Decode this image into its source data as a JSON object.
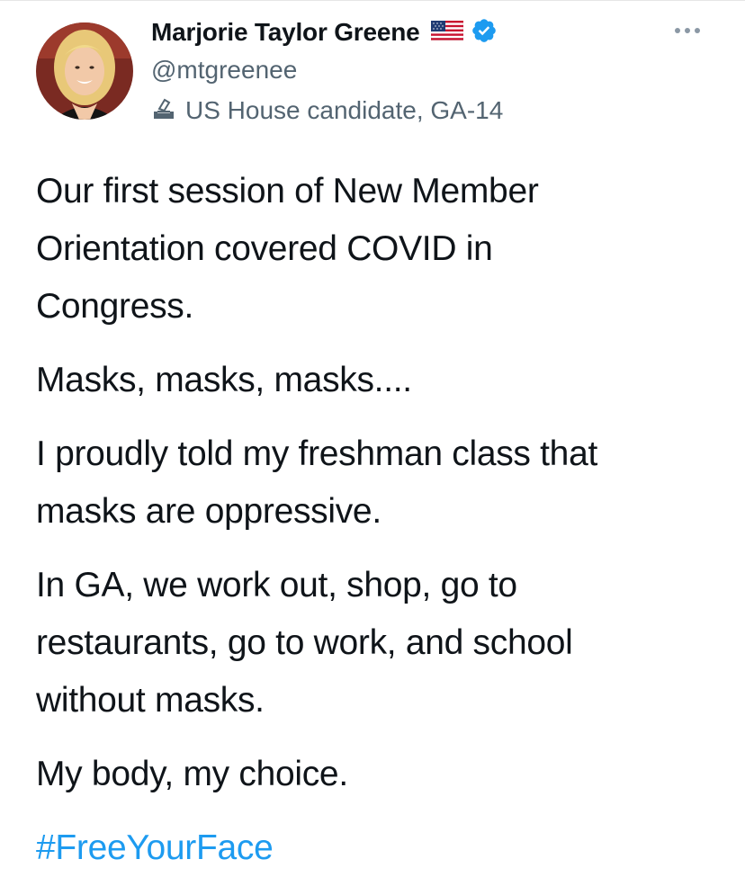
{
  "tweet": {
    "author": {
      "display_name": "Marjorie Taylor Greene",
      "handle": "@mtgreenee",
      "label": "US House candidate, GA-14",
      "verified": true,
      "flag": "us-flag-icon",
      "label_icon": "ballot-box-icon"
    },
    "paragraphs": [
      {
        "lines": [
          "Our first session of New Member",
          "Orientation covered COVID in",
          "Congress."
        ]
      },
      {
        "lines": [
          "Masks, masks, masks...."
        ]
      },
      {
        "lines": [
          "I proudly told my freshman class that",
          "masks are oppressive."
        ]
      },
      {
        "lines": [
          "In GA, we work out, shop, go to",
          "restaurants, go to work, and school",
          "without masks."
        ]
      },
      {
        "lines": [
          "My body, my choice."
        ]
      }
    ],
    "hashtag": "#FreeYourFace",
    "more_icon": "more-options-icon"
  },
  "colors": {
    "text": "#0f1419",
    "secondary": "#536471",
    "link": "#1d9bf0",
    "verified": "#1d9bf0"
  }
}
